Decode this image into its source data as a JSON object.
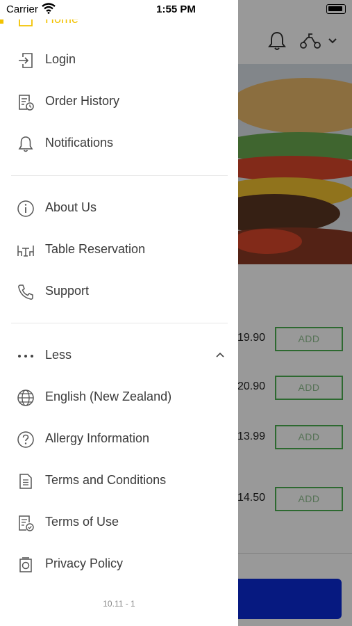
{
  "status_bar": {
    "carrier": "Carrier",
    "time": "1:55 PM"
  },
  "drawer": {
    "home_label": "Home",
    "items": [
      {
        "label": "Login",
        "icon": "login-icon"
      },
      {
        "label": "Order History",
        "icon": "order-history-icon"
      },
      {
        "label": "Notifications",
        "icon": "bell-icon"
      },
      {
        "label": "About Us",
        "icon": "info-icon"
      },
      {
        "label": "Table Reservation",
        "icon": "table-icon"
      },
      {
        "label": "Support",
        "icon": "phone-icon"
      },
      {
        "label": "Less",
        "icon": "more-dots-icon"
      },
      {
        "label": "English (New Zealand)",
        "icon": "globe-icon"
      },
      {
        "label": "Allergy Information",
        "icon": "question-icon"
      },
      {
        "label": "Terms and Conditions",
        "icon": "document-icon"
      },
      {
        "label": "Terms of Use",
        "icon": "document-check-icon"
      },
      {
        "label": "Privacy Policy",
        "icon": "privacy-icon"
      }
    ],
    "version": "10.11 - 1"
  },
  "background_screen": {
    "prices": [
      "19.90",
      "20.90",
      "13.99",
      "14.50"
    ],
    "add_label": "ADD"
  },
  "colors": {
    "accent": "#f2c200",
    "add_border": "#4caf50",
    "cart_bar": "#0a2bd6"
  }
}
